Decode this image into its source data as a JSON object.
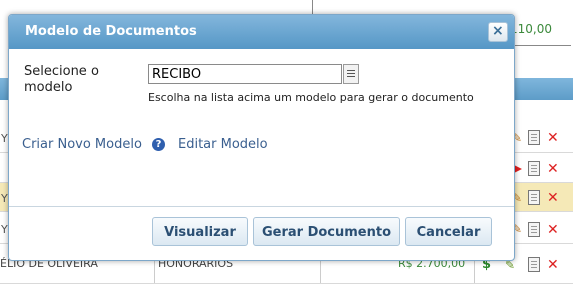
{
  "background": {
    "top_value": "110,00",
    "row_letter": "Y",
    "bottom_name": "ÉLIO DE OLIVEIRA",
    "bottom_type": "HONORÁRIOS",
    "bottom_value": "R$ 2.700,00"
  },
  "dialog": {
    "title": "Modelo de Documentos",
    "close_label": "×",
    "select_label": "Selecione o modelo",
    "select_value": "RECIBO",
    "hint": "Escolha na lista acima um modelo para gerar o documento",
    "link_new": "Criar Novo Modelo",
    "help_icon": "?",
    "link_edit": "Editar Modelo",
    "buttons": {
      "preview": "Visualizar",
      "generate": "Gerar Documento",
      "cancel": "Cancelar"
    }
  },
  "colors": {
    "titlebar": "#5d9cc8",
    "highlight_row": "#f5e9b7",
    "annotation_arrow": "#e02020"
  },
  "icons": [
    "document-icon",
    "delete-icon",
    "edit-icon",
    "payment-icon",
    "help-icon",
    "close-icon",
    "list-icon"
  ]
}
